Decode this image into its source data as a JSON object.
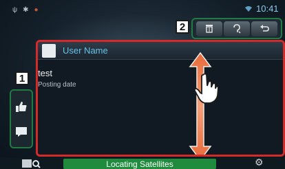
{
  "status_bar": {
    "icons": [
      "usb-icon",
      "bluetooth-icon",
      "record-icon",
      "wifi-icon"
    ],
    "time": "10:41"
  },
  "callouts": {
    "one": "1",
    "two": "2"
  },
  "toolbar": {
    "buttons": [
      {
        "icon": "trash-icon",
        "glyph": "🗑"
      },
      {
        "icon": "speech-icon",
        "glyph": "?"
      },
      {
        "icon": "back-icon",
        "glyph": "↩"
      }
    ]
  },
  "side_buttons": [
    {
      "icon": "like-icon"
    },
    {
      "icon": "comment-icon"
    }
  ],
  "post": {
    "user_name": "User Name",
    "text": "test",
    "date": "Posting date"
  },
  "bottom_bar": {
    "status": "Locating Satellites"
  },
  "colors": {
    "highlight_red": "#d42a2a",
    "highlight_green": "#1f7a43",
    "status_green": "#1f8b3d",
    "username_blue": "#66c0e6",
    "clock_blue": "#8ec9ea"
  }
}
